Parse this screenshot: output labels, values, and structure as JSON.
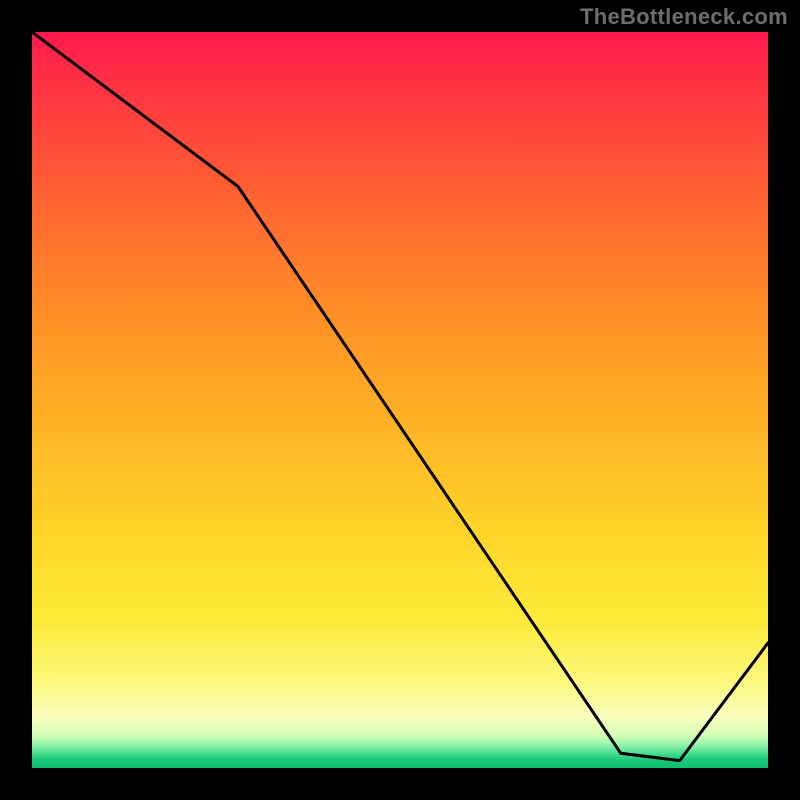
{
  "watermark": "TheBottleneck.com",
  "chart_data": {
    "type": "line",
    "title": "",
    "xlabel": "",
    "ylabel": "",
    "xlim": [
      0,
      100
    ],
    "ylim": [
      0,
      100
    ],
    "x": [
      0,
      28,
      80,
      88,
      100
    ],
    "values": [
      100,
      79,
      2,
      1,
      17
    ],
    "background_gradient_stops": [
      {
        "pos": 0,
        "color": "#ff1a4d"
      },
      {
        "pos": 0.25,
        "color": "#ff6a2f"
      },
      {
        "pos": 0.55,
        "color": "#ffb726"
      },
      {
        "pos": 0.8,
        "color": "#fdeb3a"
      },
      {
        "pos": 0.95,
        "color": "#d7ffb8"
      },
      {
        "pos": 0.99,
        "color": "#18c877"
      }
    ],
    "annotations": [
      {
        "text": "",
        "x": 82,
        "y": 1
      }
    ]
  },
  "bottom_label": ""
}
